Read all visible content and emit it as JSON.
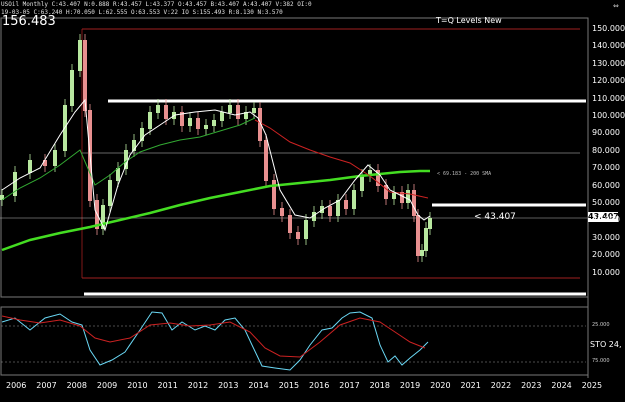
{
  "header": {
    "line1": "USOil Monthly C:43.407 N:0.888 R:43.457 L:43.377 O:43.457 B:43.407 A:43.407 V:382 OI:0",
    "line2": "19-03-05 C:63.240 H:70.050 L:62.555 O:63.553 V:22 IO S:155.493 R:8.130 N:3.570",
    "big_price": "156.483",
    "title": "T=Q Levels New"
  },
  "price_axis": [
    "150.000",
    "140.000",
    "130.000",
    "120.000",
    "110.000",
    "100.000",
    "90.000",
    "80.000",
    "70.000",
    "60.000",
    "50.000",
    "40.000",
    "30.000",
    "20.000",
    "10.000"
  ],
  "time_axis": [
    "2006",
    "2007",
    "2008",
    "2009",
    "2010",
    "2011",
    "2012",
    "2013",
    "2014",
    "2015",
    "2016",
    "2017",
    "2018",
    "2019",
    "2020",
    "2021",
    "2022",
    "2023",
    "2024",
    "2025"
  ],
  "annotations": {
    "sma_label": "< 69.183 - 200 SMA",
    "price_marker": "< 43.407",
    "price_tag": "43.407"
  },
  "oscillator": {
    "name": "STO 24,",
    "level_upper": "25.000",
    "level_lower": "75.000"
  },
  "colors": {
    "background": "#000000",
    "bull_candle": "#b8e8a0",
    "bear_candle": "#e89090",
    "sma_200": "#44dd22",
    "ma_red": "#cc2222",
    "ma_white": "#ffffff",
    "ma_green_thin": "#33aa33",
    "stoch_k": "#6ad8f5",
    "stoch_d": "#cc2222"
  },
  "icons": {
    "nav_arrows": "resize-arrows-icon"
  }
}
